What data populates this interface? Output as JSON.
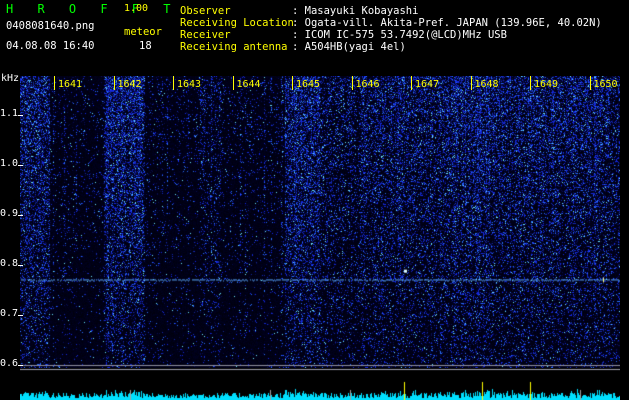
{
  "app": {
    "title": "H R O F F T",
    "version": "1.00",
    "filename": "0408081640.png",
    "datetime": "04.08.08 16:40",
    "meteor_label": "meteor",
    "meteor_count": "18"
  },
  "info": [
    {
      "label": "Observer",
      "value": ": Masayuki Kobayashi"
    },
    {
      "label": "Receiving Location",
      "value": ": Ogata-vill. Akita-Pref. JAPAN (139.96E, 40.02N)"
    },
    {
      "label": "Receiver",
      "value": ": ICOM IC-575 53.7492(@LCD)MHz USB"
    },
    {
      "label": "Receiving antenna",
      "value": ": A504HB(yagi 4el)"
    }
  ],
  "axis": {
    "y_unit": "kHz",
    "y_ticks": [
      "1.1",
      "1.0",
      "0.9",
      "0.8",
      "0.7",
      "0.6"
    ],
    "minutes": [
      "1641",
      "1642",
      "1643",
      "1644",
      "1645",
      "1646",
      "1647",
      "1648",
      "1649",
      "1650"
    ]
  },
  "colors": {
    "background": "#000000",
    "title_green": "#00ff00",
    "label_yellow": "#ffff00",
    "text_white": "#ffffff",
    "signal_blue": "#1e3cff",
    "signal_cyan": "#00e0ff"
  },
  "spectrogram": {
    "y_range_khz": [
      0.58,
      1.19
    ],
    "carrier_khz": 0.765,
    "ping_khz": 0.775
  }
}
